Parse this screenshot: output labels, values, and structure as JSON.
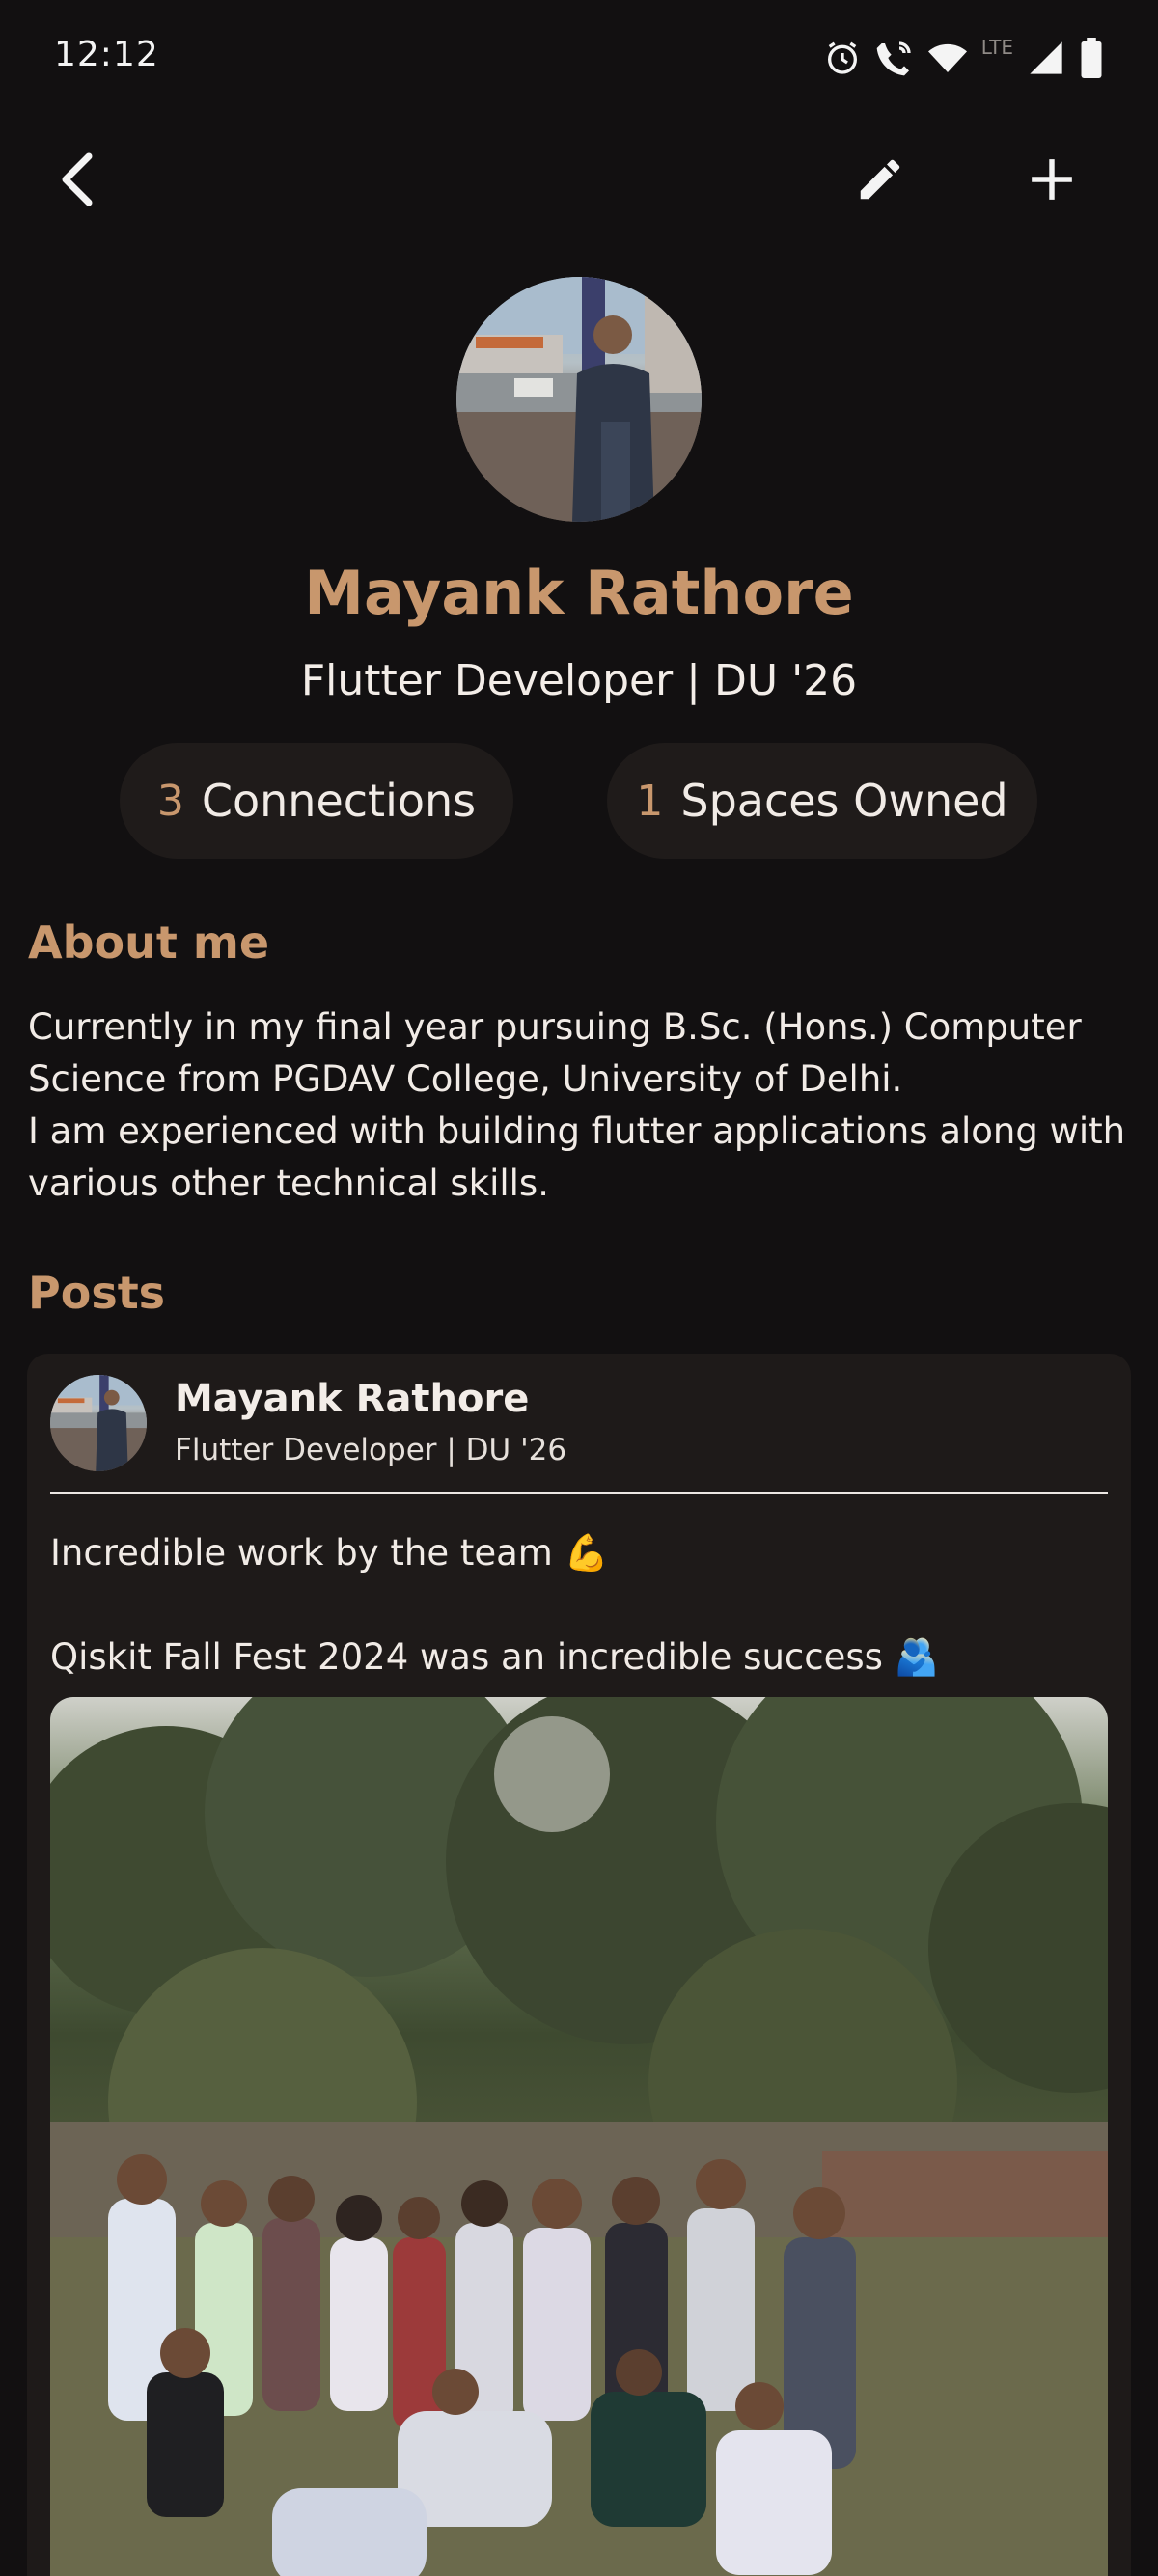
{
  "status_bar": {
    "time": "12:12",
    "network_label": "LTE",
    "icons": [
      "alarm-icon",
      "wifi-calling-icon",
      "wifi-icon",
      "signal-icon",
      "battery-icon"
    ]
  },
  "top_bar": {
    "icons": [
      "back-chevron-icon",
      "edit-pencil-icon",
      "add-plus-icon"
    ]
  },
  "profile": {
    "name": "Mayank Rathore",
    "title": "Flutter Developer | DU '26",
    "stats": {
      "connections_count": "3",
      "connections_label": "Connections",
      "spaces_count": "1",
      "spaces_label": "Spaces Owned"
    }
  },
  "about": {
    "heading": "About me",
    "text": "Currently in my final year pursuing B.Sc. (Hons.) Computer Science from PGDAV College, University of Delhi.\nI am experienced with building flutter applications along with various other technical skills."
  },
  "posts": {
    "heading": "Posts",
    "items": [
      {
        "author": "Mayank Rathore",
        "author_title": "Flutter Developer | DU '26",
        "text": "Incredible work by the team 💪\n\nQiskit Fall Fest 2024 was an incredible success 🫂"
      }
    ]
  },
  "colors": {
    "background": "#121011",
    "accent": "#c8976d",
    "card": "#1e1a19",
    "pill": "#1f1b1a",
    "text": "#f1ebe6"
  }
}
